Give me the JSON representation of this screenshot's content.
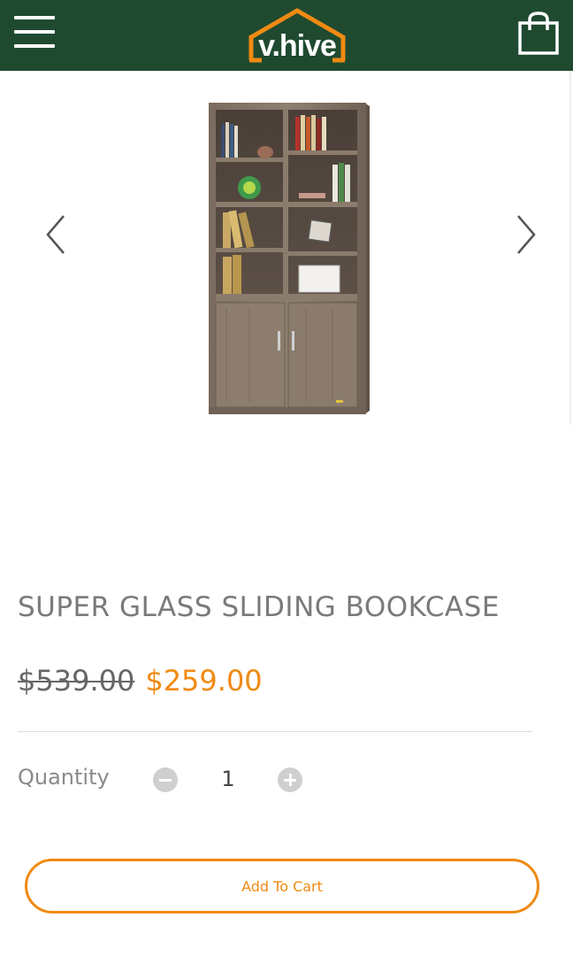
{
  "header": {
    "logo_text": "v.hive",
    "menu_icon": "hamburger-menu-icon",
    "cart_icon": "shopping-bag-icon",
    "background_color": "#1f4a30",
    "logo_accent_color": "#f08a12"
  },
  "gallery": {
    "prev_icon": "chevron-left-icon",
    "next_icon": "chevron-right-icon",
    "image_subject": "bookcase"
  },
  "product": {
    "title": "SUPER GLASS SLIDING BOOKCASE",
    "price_original": "$539.00",
    "price_sale": "$259.00",
    "sale_color": "#f08a12"
  },
  "quantity": {
    "label": "Quantity",
    "value": "1",
    "minus_icon": "minus-circle-icon",
    "plus_icon": "plus-circle-icon"
  },
  "actions": {
    "add_to_cart_label": "Add To Cart"
  }
}
